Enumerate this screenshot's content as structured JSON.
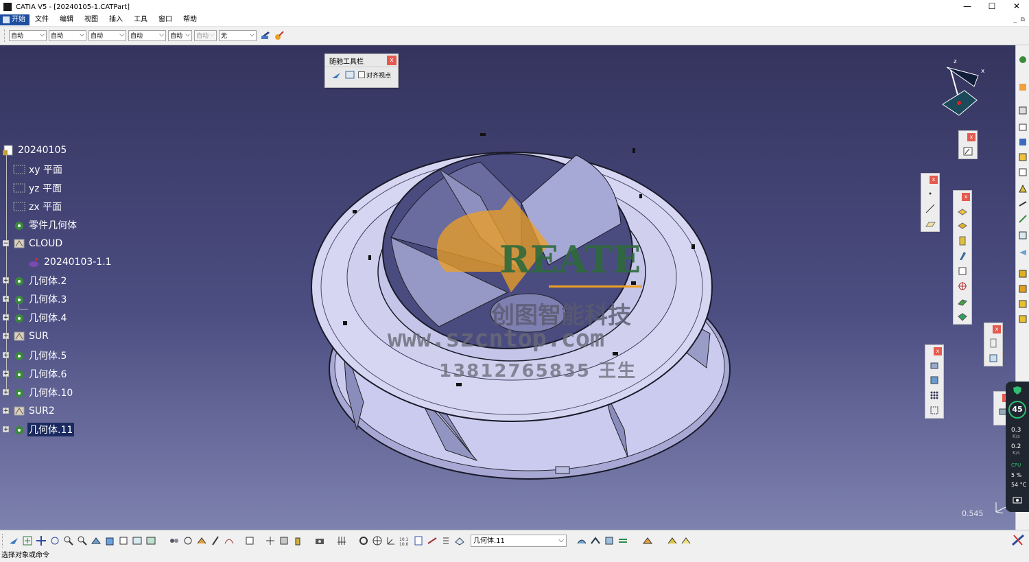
{
  "window": {
    "title": "CATIA V5 - [20240105-1.CATPart]",
    "min": "—",
    "max": "☐",
    "close": "✕"
  },
  "menu": {
    "items": [
      "开始",
      "文件",
      "编辑",
      "视图",
      "插入",
      "工具",
      "窗口",
      "帮助"
    ]
  },
  "toolbar": {
    "dropdowns": [
      "自动",
      "自动",
      "自动",
      "自动",
      "自动",
      "自动",
      "无"
    ]
  },
  "float_toolbar": {
    "title": "随驰工具栏",
    "checkbox_label": "对齐视点",
    "close": "x"
  },
  "tree": {
    "root": "20240105",
    "items": [
      "xy 平面",
      "yz 平面",
      "zx 平面",
      "零件几何体",
      "CLOUD",
      "20240103-1.1",
      "几何体.2",
      "几何体.3",
      "几何体.4",
      "SUR",
      "几何体.5",
      "几何体.6",
      "几何体.10",
      "SUR2",
      "几何体.11"
    ]
  },
  "watermark": {
    "brand": "REATE",
    "company": "创图智能科技",
    "url": "www.szcntop.com",
    "phone": "13812765835 王生"
  },
  "compass": {
    "x_label": "x",
    "z_label": "z"
  },
  "scale_value": "0.545",
  "perf_widget": {
    "percent": "45",
    "upload": "0.3",
    "download": "0.2",
    "unit": "K/s",
    "cpu_label": "CPU",
    "cpu_percent": "5 %",
    "temp": "54 °C"
  },
  "bottom_toolbar": {
    "body_select": "几何体.11"
  },
  "statusbar": {
    "text": "选择对象或命令"
  },
  "colors": {
    "viewport_top": "#34345e",
    "viewport_bottom": "#7e82ae",
    "part": "#d6d6f2",
    "brand_orange": "#f0a020",
    "brand_green": "#2e6a3c"
  }
}
